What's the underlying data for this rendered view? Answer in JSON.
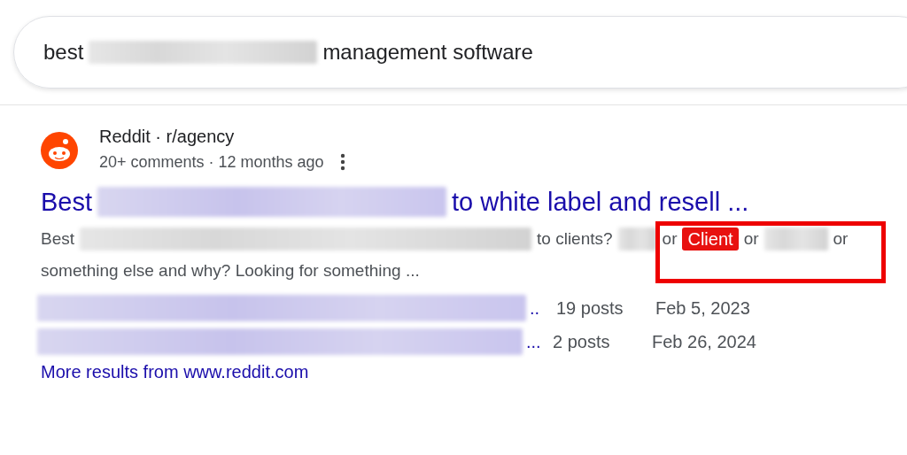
{
  "search": {
    "query": [
      {
        "kind": "text",
        "text": "best"
      },
      {
        "kind": "redacted"
      },
      {
        "kind": "text",
        "text": "management software"
      }
    ]
  },
  "result": {
    "source": "Reddit · r/agency",
    "meta": "20+ comments · 12 months ago",
    "title": [
      {
        "kind": "text",
        "text": "Best"
      },
      {
        "kind": "redacted"
      },
      {
        "kind": "text",
        "text": "to white label and resell ..."
      }
    ],
    "snippet_line_1": [
      {
        "kind": "text",
        "text": "Best"
      },
      {
        "kind": "redacted"
      },
      {
        "kind": "text",
        "text": "to clients?"
      },
      {
        "kind": "redacted"
      },
      {
        "kind": "text",
        "text": "or"
      },
      {
        "kind": "highlight",
        "text": "Client"
      },
      {
        "kind": "text",
        "text": "or"
      },
      {
        "kind": "redacted"
      },
      {
        "kind": "text",
        "text": "or"
      }
    ],
    "snippet_line_2": "something else and why? Looking for something ...",
    "related": [
      {
        "ellipsis": "..",
        "posts": "19 posts",
        "date": "Feb 5, 2023"
      },
      {
        "ellipsis": "...",
        "posts": "2 posts",
        "date": "Feb 26, 2024"
      }
    ],
    "more_link": "More results from www.reddit.com"
  },
  "annotation": {
    "kind": "rectangle"
  }
}
